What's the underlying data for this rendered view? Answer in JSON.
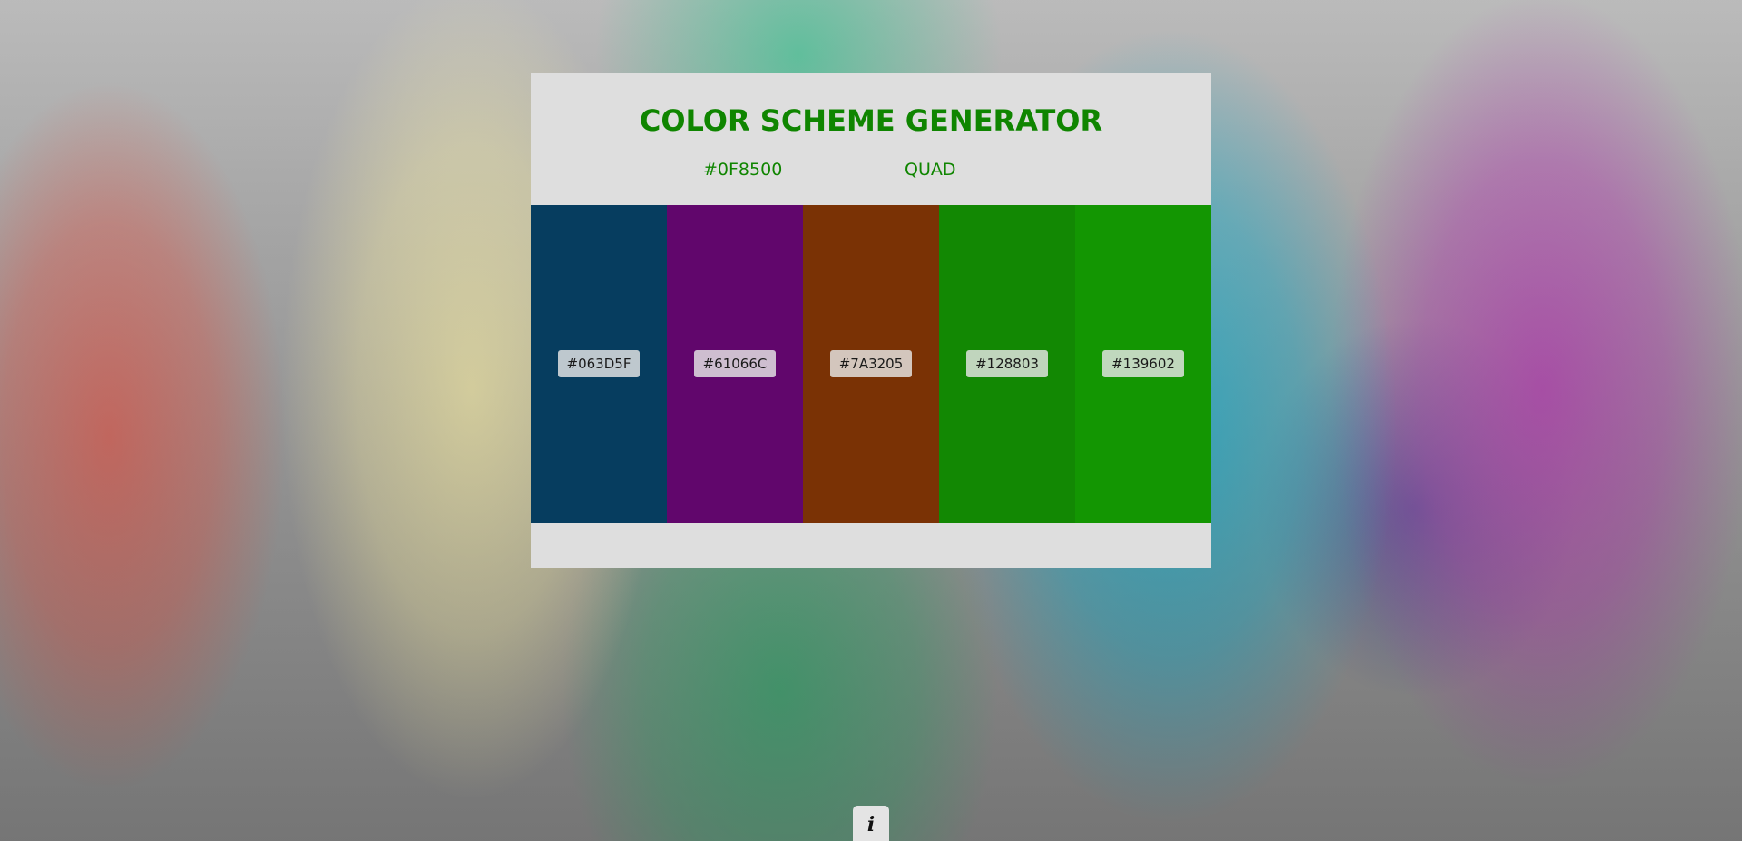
{
  "app": {
    "title": "COLOR SCHEME GENERATOR"
  },
  "scheme": {
    "seed_hex": "#0F8500",
    "mode": "QUAD",
    "accent_color": "#0f8500"
  },
  "swatches": [
    {
      "hex": "#063D5F",
      "color": "#063D5F"
    },
    {
      "hex": "#61066C",
      "color": "#61066C"
    },
    {
      "hex": "#7A3205",
      "color": "#7A3205"
    },
    {
      "hex": "#128803",
      "color": "#128803"
    },
    {
      "hex": "#139602",
      "color": "#139602"
    }
  ],
  "info_button": {
    "label": "i",
    "icon": "info-icon"
  }
}
